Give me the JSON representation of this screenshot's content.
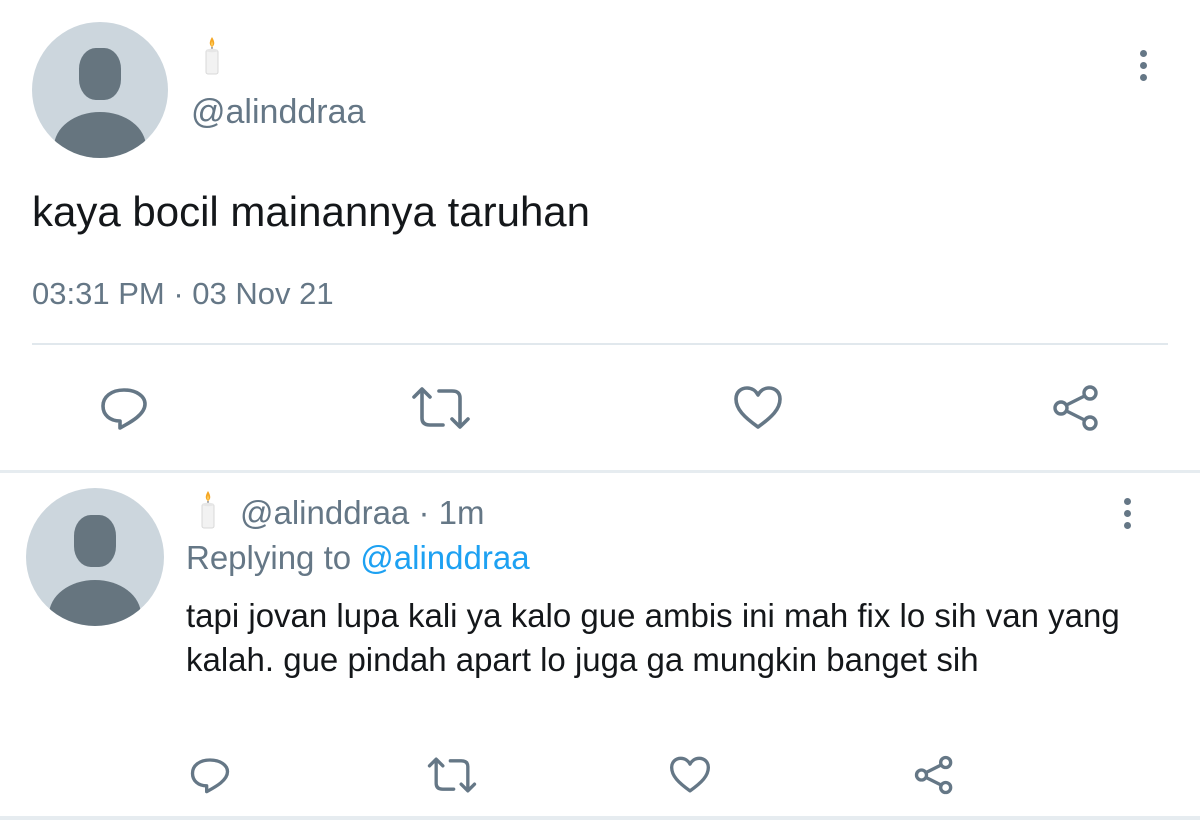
{
  "main_tweet": {
    "handle": "@alinddraa",
    "text": "kaya bocil mainannya taruhan",
    "time": "03:31 PM",
    "separator": "·",
    "date": "03 Nov 21"
  },
  "reply_tweet": {
    "handle": "@alinddraa",
    "separator": "·",
    "age": "1m",
    "replying_prefix": "Replying to",
    "replying_to": "@alinddraa",
    "text": "tapi jovan lupa kali ya kalo gue ambis ini mah fix lo sih van yang kalah. gue pindah apart lo juga ga mungkin banget sih"
  },
  "icons": {
    "avatar": "default-avatar-icon",
    "name_emoji": "candle-icon",
    "more": "more-vertical-icon",
    "reply": "reply-icon",
    "retweet": "retweet-icon",
    "like": "heart-icon",
    "share": "share-icon"
  },
  "colors": {
    "text": "#14171a",
    "muted": "#657786",
    "link": "#1da1f2",
    "avatar_bg": "#ccd6dd",
    "avatar_fg": "#66757f",
    "divider": "#e1e8ed"
  }
}
